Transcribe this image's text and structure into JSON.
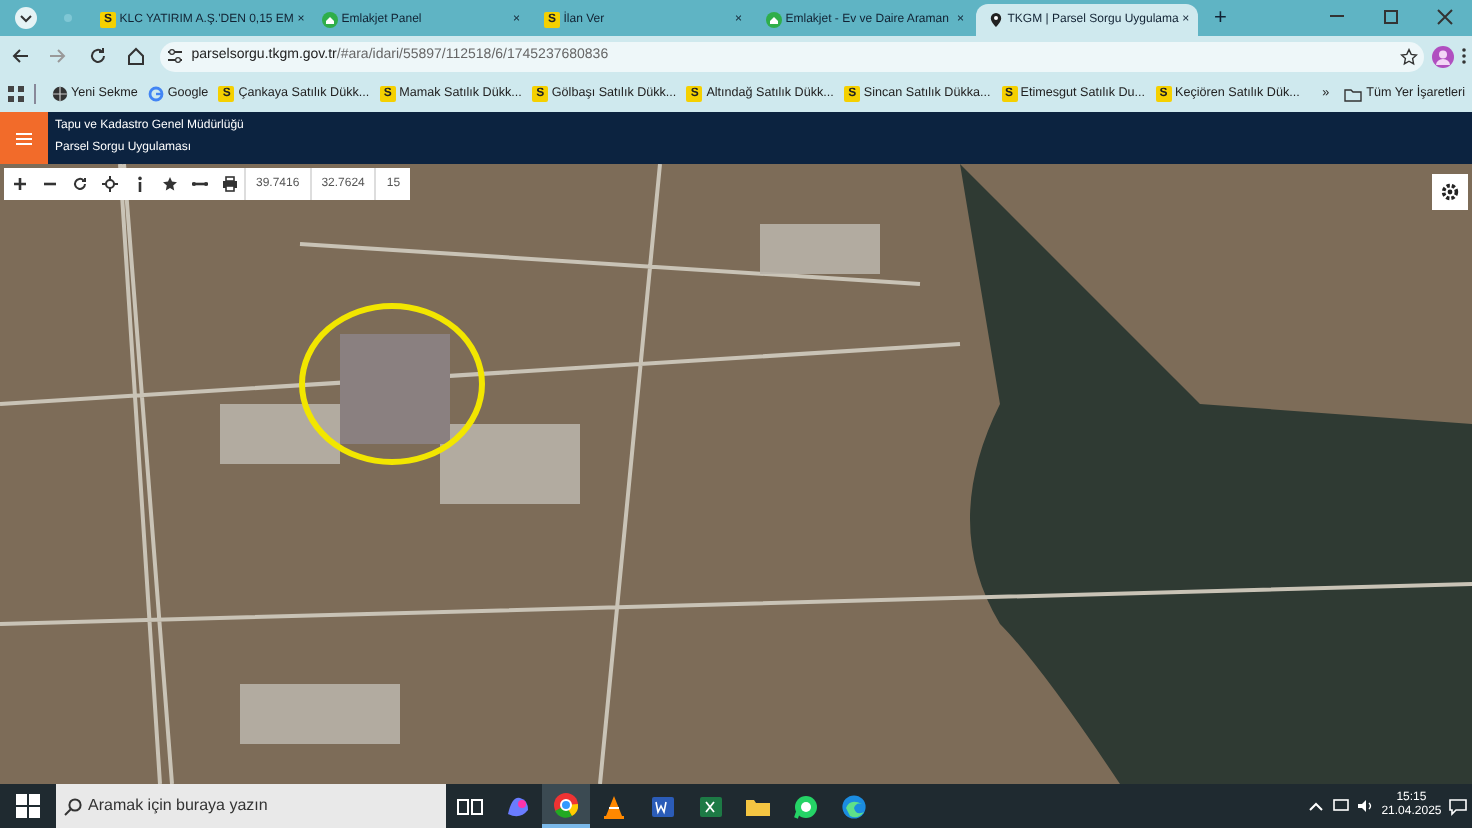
{
  "browser": {
    "tabs": [
      {
        "title": "KLC YATIRIM A.Ş.'DEN 0,15 EM",
        "kind": "letter",
        "letter": "S",
        "close": "×",
        "selected": false
      },
      {
        "title": "Emlakjet Panel",
        "kind": "house",
        "close": "×",
        "selected": false
      },
      {
        "title": "İlan Ver",
        "kind": "letter",
        "letter": "S",
        "close": "×",
        "selected": false
      },
      {
        "title": "Emlakjet - Ev ve Daire Araman",
        "kind": "house",
        "close": "×",
        "selected": false
      },
      {
        "title": "TKGM | Parsel Sorgu Uygulama",
        "kind": "pin",
        "close": "×",
        "selected": true
      }
    ],
    "new_tab": "+",
    "address": {
      "host": "parselsorgu.tkgm.gov.tr",
      "path": "/#ara/idari/55897/112518/6/1745237680836"
    },
    "bookmarks": [
      {
        "label": "Yeni Sekme",
        "kind": "globe"
      },
      {
        "label": "Google",
        "kind": "google"
      },
      {
        "label": "Çankaya Satılık Dükk...",
        "kind": "letter",
        "letter": "S"
      },
      {
        "label": "Mamak Satılık Dükk...",
        "kind": "letter",
        "letter": "S"
      },
      {
        "label": "Gölbaşı Satılık Dükk...",
        "kind": "letter",
        "letter": "S"
      },
      {
        "label": "Altındağ Satılık Dükk...",
        "kind": "letter",
        "letter": "S"
      },
      {
        "label": "Sincan Satılık Dükka...",
        "kind": "letter",
        "letter": "S"
      },
      {
        "label": "Etimesgut Satılık Du...",
        "kind": "letter",
        "letter": "S"
      },
      {
        "label": "Keçiören Satılık Dük...",
        "kind": "letter",
        "letter": "S"
      }
    ],
    "more_bookmarks": "»",
    "all_bookmarks": "Tüm Yer İşaretleri"
  },
  "app_header": {
    "title": "Tapu ve Kadastro Genel Müdürlüğü",
    "subtitle": "Parsel Sorgu Uygulaması"
  },
  "map": {
    "toolbar": {
      "latitude": "39.7416",
      "longitude": "32.7624",
      "zoom": "15"
    }
  },
  "taskbar": {
    "search_placeholder": "Aramak için buraya yazın",
    "apps": [
      {
        "kind": "taskview",
        "selected": false
      },
      {
        "kind": "copilot",
        "selected": false
      },
      {
        "kind": "chrome",
        "selected": true
      },
      {
        "kind": "vlc",
        "selected": false
      },
      {
        "kind": "word",
        "selected": false
      },
      {
        "kind": "excel",
        "selected": false
      },
      {
        "kind": "explorer",
        "selected": false
      },
      {
        "kind": "whatsapp",
        "selected": false
      },
      {
        "kind": "edge",
        "selected": false
      }
    ],
    "time": "15:15",
    "date": "21.04.2025"
  }
}
